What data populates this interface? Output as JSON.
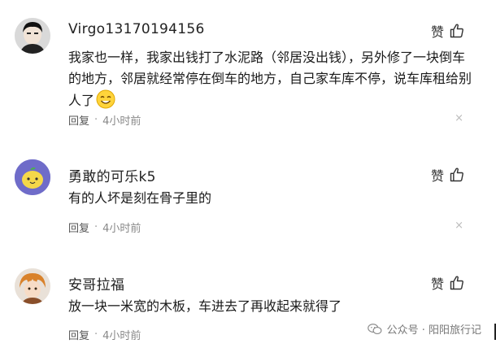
{
  "comments": [
    {
      "username": "Virgo13170194156",
      "text": "我家也一样，我家出钱打了水泥路（邻居没出钱），另外修了一块倒车的地方，邻居就经常停在倒车的地方，自己家车库不停，说车库租给别人了",
      "emoji": "smiling-face-emoji",
      "reply_label": "回复",
      "time": "4小时前",
      "like_label": "赞"
    },
    {
      "username": "勇敢的可乐k5",
      "text": "有的人坏是刻在骨子里的",
      "reply_label": "回复",
      "time": "4小时前",
      "like_label": "赞"
    },
    {
      "username": "安哥拉福",
      "text": "放一块一米宽的木板，车进去了再收起来就得了",
      "reply_label": "回复",
      "time": "4小时前",
      "like_label": "赞"
    }
  ],
  "dot": "·",
  "close_glyph": "×",
  "watermark": "公众号 · 阳阳旅行记",
  "colors": {
    "text": "#1a1a1a",
    "meta": "#888888",
    "accent_lemon": "#f5d84a",
    "avatar_bg_2": "#6f6cc9"
  }
}
